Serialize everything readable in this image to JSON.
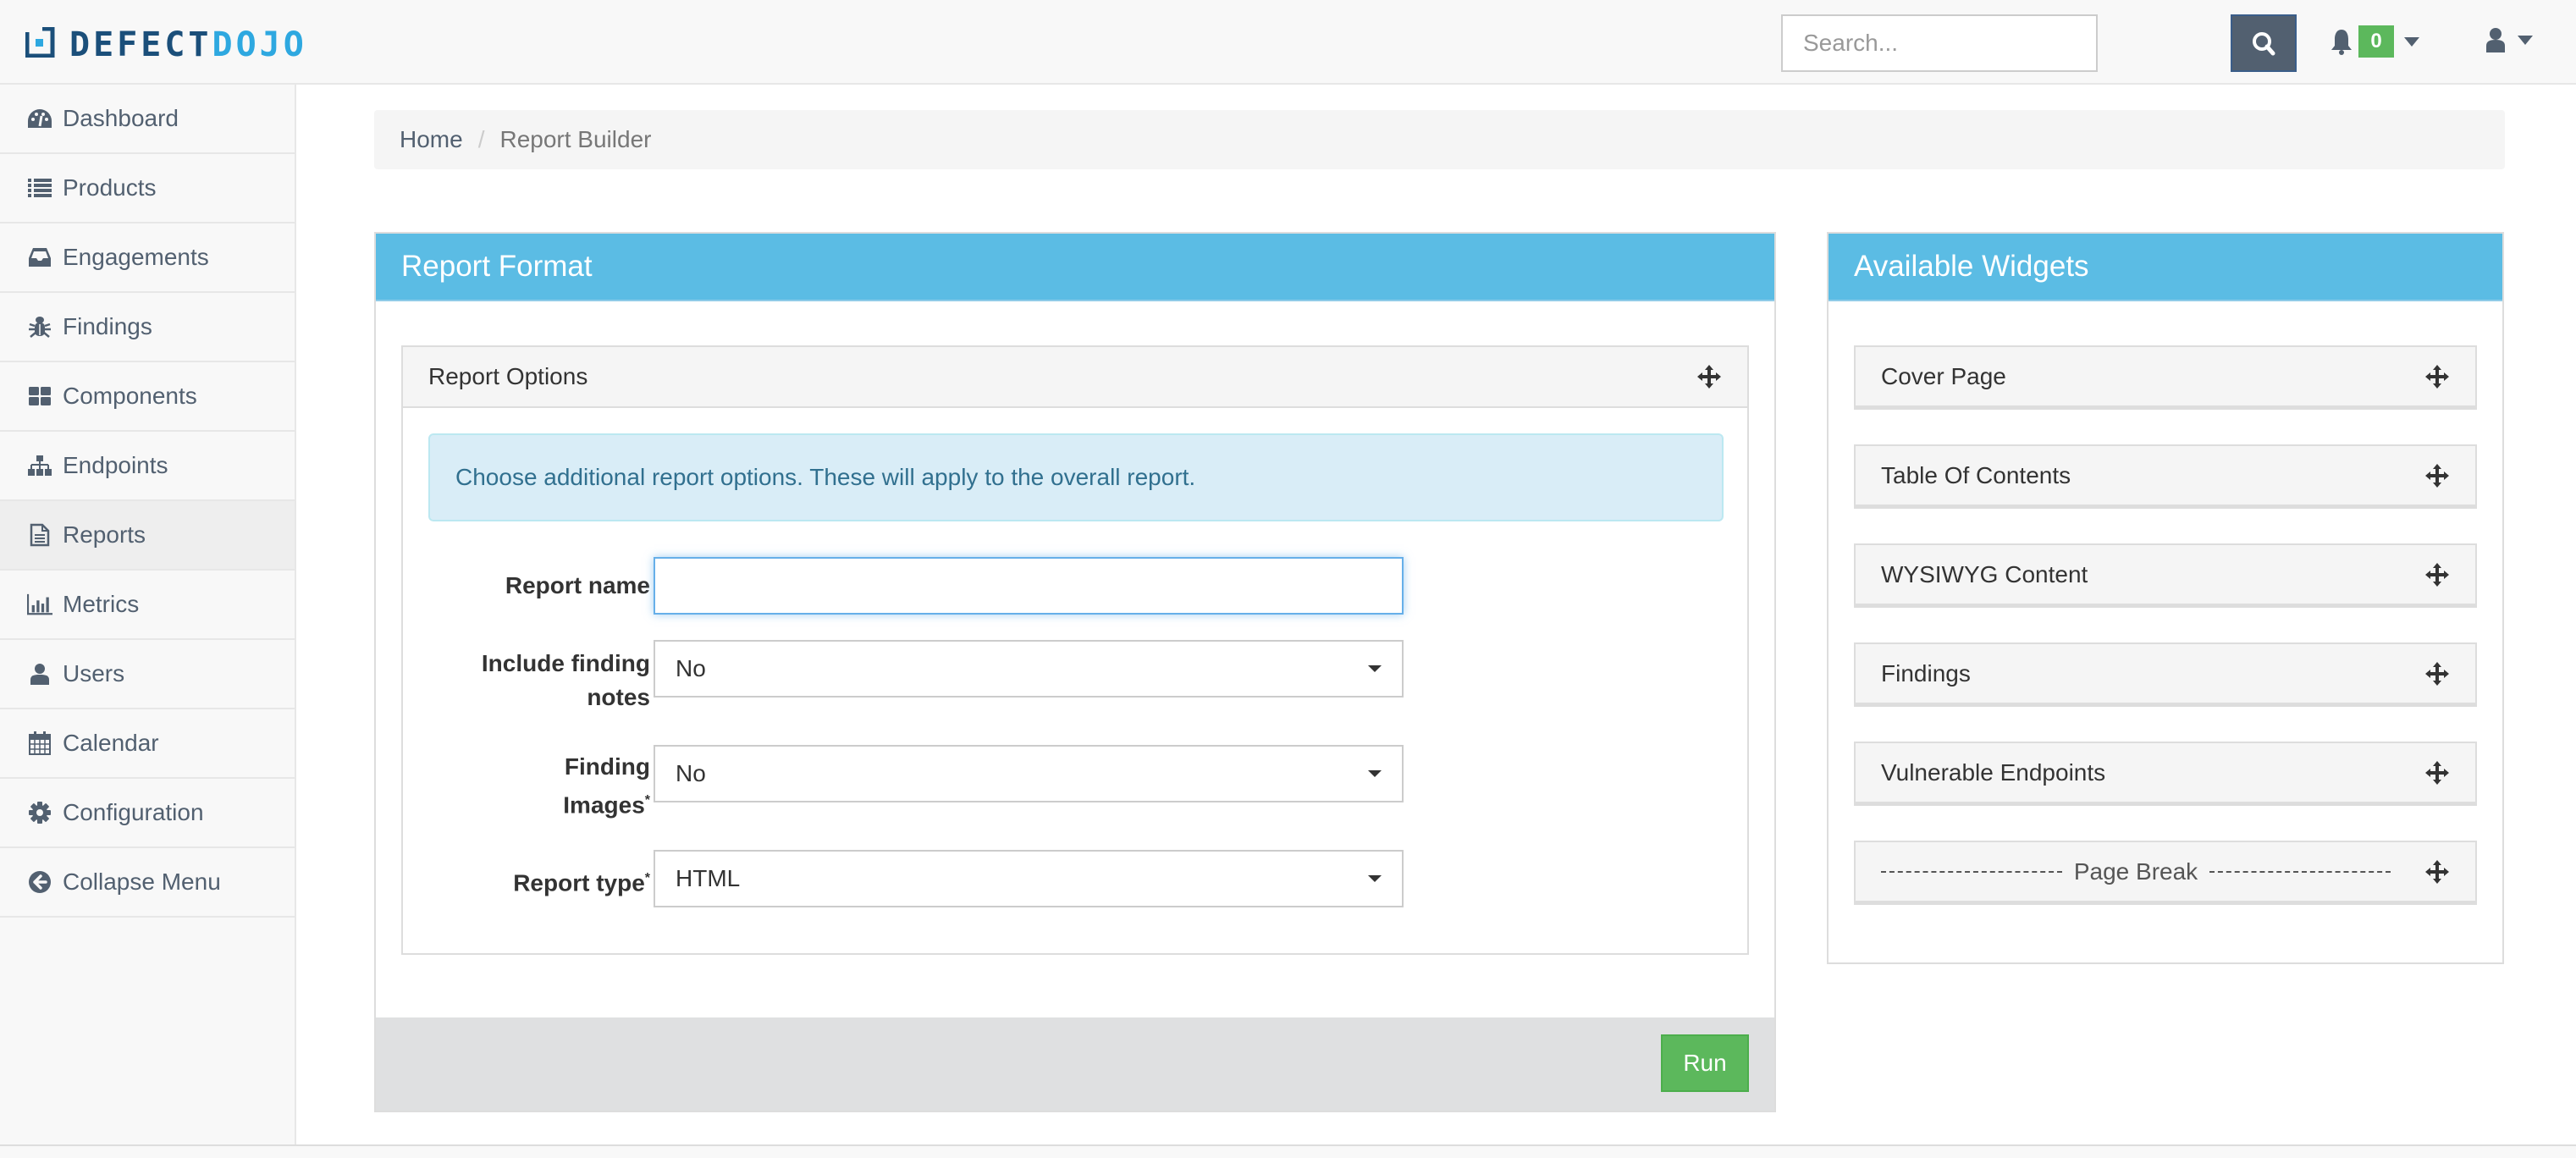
{
  "brand": {
    "part1": "DEFECT",
    "part2": "DOJO",
    "color1": "#1b4f7a",
    "color2": "#2ea8e0"
  },
  "navbar": {
    "search_placeholder": "Search...",
    "search_value": "",
    "notification_count": "0"
  },
  "sidebar": {
    "items": [
      {
        "label": "Dashboard",
        "icon": "dashboard-icon"
      },
      {
        "label": "Products",
        "icon": "list-icon"
      },
      {
        "label": "Engagements",
        "icon": "inbox-icon"
      },
      {
        "label": "Findings",
        "icon": "bug-icon"
      },
      {
        "label": "Components",
        "icon": "grid-icon"
      },
      {
        "label": "Endpoints",
        "icon": "sitemap-icon"
      },
      {
        "label": "Reports",
        "icon": "file-text-icon",
        "active": true
      },
      {
        "label": "Metrics",
        "icon": "bar-chart-icon"
      },
      {
        "label": "Users",
        "icon": "user-icon"
      },
      {
        "label": "Calendar",
        "icon": "calendar-icon"
      },
      {
        "label": "Configuration",
        "icon": "gear-icon"
      },
      {
        "label": "Collapse Menu",
        "icon": "arrow-circle-left-icon"
      }
    ]
  },
  "breadcrumb": {
    "home": "Home",
    "current": "Report Builder"
  },
  "report_format": {
    "title": "Report Format",
    "options_title": "Report Options",
    "alert": "Choose additional report options. These will apply to the overall report.",
    "fields": {
      "report_name": {
        "label": "Report name",
        "value": ""
      },
      "include_notes": {
        "label": "Include finding notes",
        "value": "No"
      },
      "finding_images": {
        "label": "Finding Images",
        "required": "*",
        "value": "No"
      },
      "report_type": {
        "label": "Report type",
        "required": "*",
        "value": "HTML"
      }
    },
    "run_label": "Run"
  },
  "widgets": {
    "title": "Available Widgets",
    "items": [
      "Cover Page",
      "Table Of Contents",
      "WYSIWYG Content",
      "Findings",
      "Vulnerable Endpoints"
    ],
    "page_break": "Page Break"
  },
  "colors": {
    "panel_heading": "#5bbce4",
    "run_button": "#5cb85c",
    "badge": "#5cb85c",
    "nav_text": "#526070"
  }
}
